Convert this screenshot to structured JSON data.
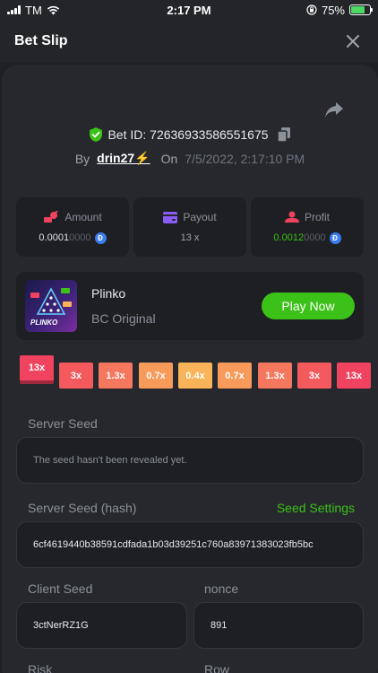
{
  "status_bar": {
    "carrier": "TM",
    "time": "2:17 PM",
    "battery": "75%",
    "battery_level": 0.75
  },
  "header": {
    "title": "Bet Slip"
  },
  "bet": {
    "id_text": "Bet ID: 72636933586551675",
    "by_label": "By",
    "user": "drin27⚡",
    "on_label": "On",
    "date": "7/5/2022, 2:17:10 PM"
  },
  "stats": {
    "amount": {
      "label": "Amount",
      "value_bright": "0.0001",
      "value_dim": "0000"
    },
    "payout": {
      "label": "Payout",
      "value": "13 x"
    },
    "profit": {
      "label": "Profit",
      "value_bright": "0.0012",
      "value_dim": "0000"
    }
  },
  "game": {
    "name": "Plinko",
    "provider": "BC Original",
    "play_label": "Play Now",
    "thumb_label": "PLINKO"
  },
  "multipliers": [
    {
      "label": "13x",
      "color": "#f0435f"
    },
    {
      "label": "3x",
      "color": "#f45a5d"
    },
    {
      "label": "1.3x",
      "color": "#f5775d"
    },
    {
      "label": "0.7x",
      "color": "#f89a5a"
    },
    {
      "label": "0.4x",
      "color": "#f9b358"
    },
    {
      "label": "0.7x",
      "color": "#f89a5a"
    },
    {
      "label": "1.3x",
      "color": "#f5775d"
    },
    {
      "label": "3x",
      "color": "#f45a5d"
    },
    {
      "label": "13x",
      "color": "#f0435f"
    }
  ],
  "server_seed": {
    "label": "Server Seed",
    "placeholder": "The seed hasn't been revealed yet."
  },
  "server_seed_hash": {
    "label": "Server Seed (hash)",
    "settings_label": "Seed Settings",
    "value": "6cf4619440b38591cdfada1b03d39251c760a83971383023fb5bc"
  },
  "client_seed": {
    "label": "Client Seed",
    "value": "3ctNerRZ1G"
  },
  "nonce": {
    "label": "nonce",
    "value": "891"
  },
  "risk": {
    "label": "Risk"
  },
  "row": {
    "label": "Row"
  },
  "colors": {
    "accent_green": "#3bc117",
    "coin_blue": "#3a7cf2"
  }
}
